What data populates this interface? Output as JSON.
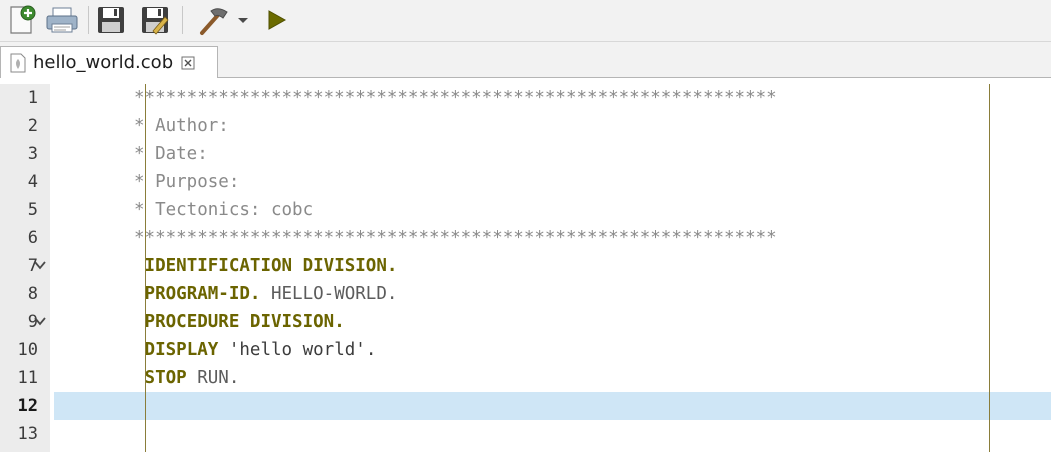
{
  "toolbar": {
    "buttons": [
      {
        "name": "new-file-button",
        "icon": "new-file-icon"
      },
      {
        "name": "print-button",
        "icon": "printer-icon"
      },
      {
        "name": "save-button",
        "icon": "save-icon"
      },
      {
        "name": "save-as-button",
        "icon": "save-as-icon"
      },
      {
        "name": "build-button",
        "icon": "hammer-icon"
      },
      {
        "name": "build-dropdown",
        "icon": "chevron-down-icon"
      },
      {
        "name": "run-button",
        "icon": "play-icon"
      }
    ]
  },
  "tab": {
    "filename": "hello_world.cob",
    "close_glyph": "⊠"
  },
  "editor": {
    "current_line": 12,
    "lines": [
      {
        "num": "1",
        "fold": false,
        "parts": [
          {
            "cls": "comment",
            "text": "*************************************************************"
          }
        ]
      },
      {
        "num": "2",
        "fold": false,
        "parts": [
          {
            "cls": "comment",
            "text": "* Author:"
          }
        ]
      },
      {
        "num": "3",
        "fold": false,
        "parts": [
          {
            "cls": "comment",
            "text": "* Date:"
          }
        ]
      },
      {
        "num": "4",
        "fold": false,
        "parts": [
          {
            "cls": "comment",
            "text": "* Purpose:"
          }
        ]
      },
      {
        "num": "5",
        "fold": false,
        "parts": [
          {
            "cls": "comment",
            "text": "* Tectonics: cobc"
          }
        ]
      },
      {
        "num": "6",
        "fold": false,
        "parts": [
          {
            "cls": "comment",
            "text": "*************************************************************"
          }
        ]
      },
      {
        "num": "7",
        "fold": true,
        "parts": [
          {
            "cls": "plain",
            "text": " "
          },
          {
            "cls": "kw",
            "text": "IDENTIFICATION DIVISION."
          }
        ]
      },
      {
        "num": "8",
        "fold": false,
        "parts": [
          {
            "cls": "plain",
            "text": " "
          },
          {
            "cls": "kw",
            "text": "PROGRAM-ID."
          },
          {
            "cls": "plain",
            "text": " HELLO-WORLD."
          }
        ]
      },
      {
        "num": "9",
        "fold": true,
        "parts": [
          {
            "cls": "plain",
            "text": " "
          },
          {
            "cls": "kw",
            "text": "PROCEDURE DIVISION."
          }
        ]
      },
      {
        "num": "10",
        "fold": false,
        "parts": [
          {
            "cls": "plain",
            "text": " "
          },
          {
            "cls": "kw",
            "text": "DISPLAY"
          },
          {
            "cls": "str",
            "text": " 'hello world'."
          }
        ]
      },
      {
        "num": "11",
        "fold": false,
        "parts": [
          {
            "cls": "plain",
            "text": " "
          },
          {
            "cls": "kw",
            "text": "STOP"
          },
          {
            "cls": "plain",
            "text": " RUN."
          }
        ]
      },
      {
        "num": "12",
        "fold": false,
        "parts": []
      },
      {
        "num": "13",
        "fold": false,
        "parts": []
      }
    ]
  },
  "colors": {
    "keyword": "#6b6400",
    "comment": "#8a8a8a",
    "current_line": "#cfe6f6",
    "margin_line": "#8a7d3a"
  }
}
